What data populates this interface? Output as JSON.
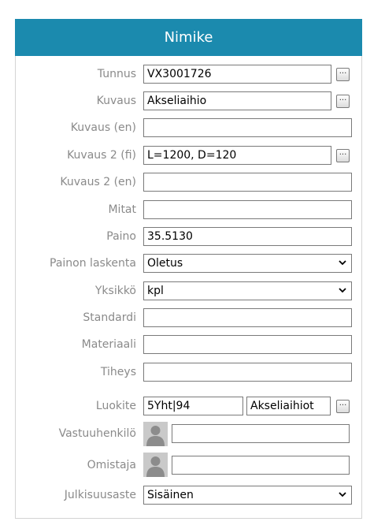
{
  "header": {
    "title": "Nimike"
  },
  "fields": {
    "tunnus": {
      "label": "Tunnus",
      "value": "VX3001726"
    },
    "kuvaus": {
      "label": "Kuvaus",
      "value": "Akseliaihio"
    },
    "kuvaus_en": {
      "label": "Kuvaus (en)",
      "value": ""
    },
    "kuvaus2_fi": {
      "label": "Kuvaus 2 (fi)",
      "value": "L=1200, D=120"
    },
    "kuvaus2_en": {
      "label": "Kuvaus 2 (en)",
      "value": ""
    },
    "mitat": {
      "label": "Mitat",
      "value": ""
    },
    "paino": {
      "label": "Paino",
      "value": "35.5130"
    },
    "painon_laskenta": {
      "label": "Painon laskenta",
      "value": "Oletus"
    },
    "yksikko": {
      "label": "Yksikkö",
      "value": "kpl"
    },
    "standardi": {
      "label": "Standardi",
      "value": ""
    },
    "materiaali": {
      "label": "Materiaali",
      "value": ""
    },
    "tiheys": {
      "label": "Tiheys",
      "value": ""
    },
    "luokite": {
      "label": "Luokite",
      "code": "5Yht|94",
      "name": "Akseliaihiot"
    },
    "vastuuhenkilo": {
      "label": "Vastuuhenkilö",
      "value": ""
    },
    "omistaja": {
      "label": "Omistaja",
      "value": ""
    },
    "julkisuusaste": {
      "label": "Julkisuusaste",
      "value": "Sisäinen"
    }
  },
  "ellipsis_label": "...",
  "icons": {
    "ellipsis": "ellipsis-button-icon",
    "dropdown": "chevron-down-icon",
    "user": "user-placeholder-icon"
  },
  "colors": {
    "header": "#1b8aae",
    "label": "#8a8a8a"
  }
}
